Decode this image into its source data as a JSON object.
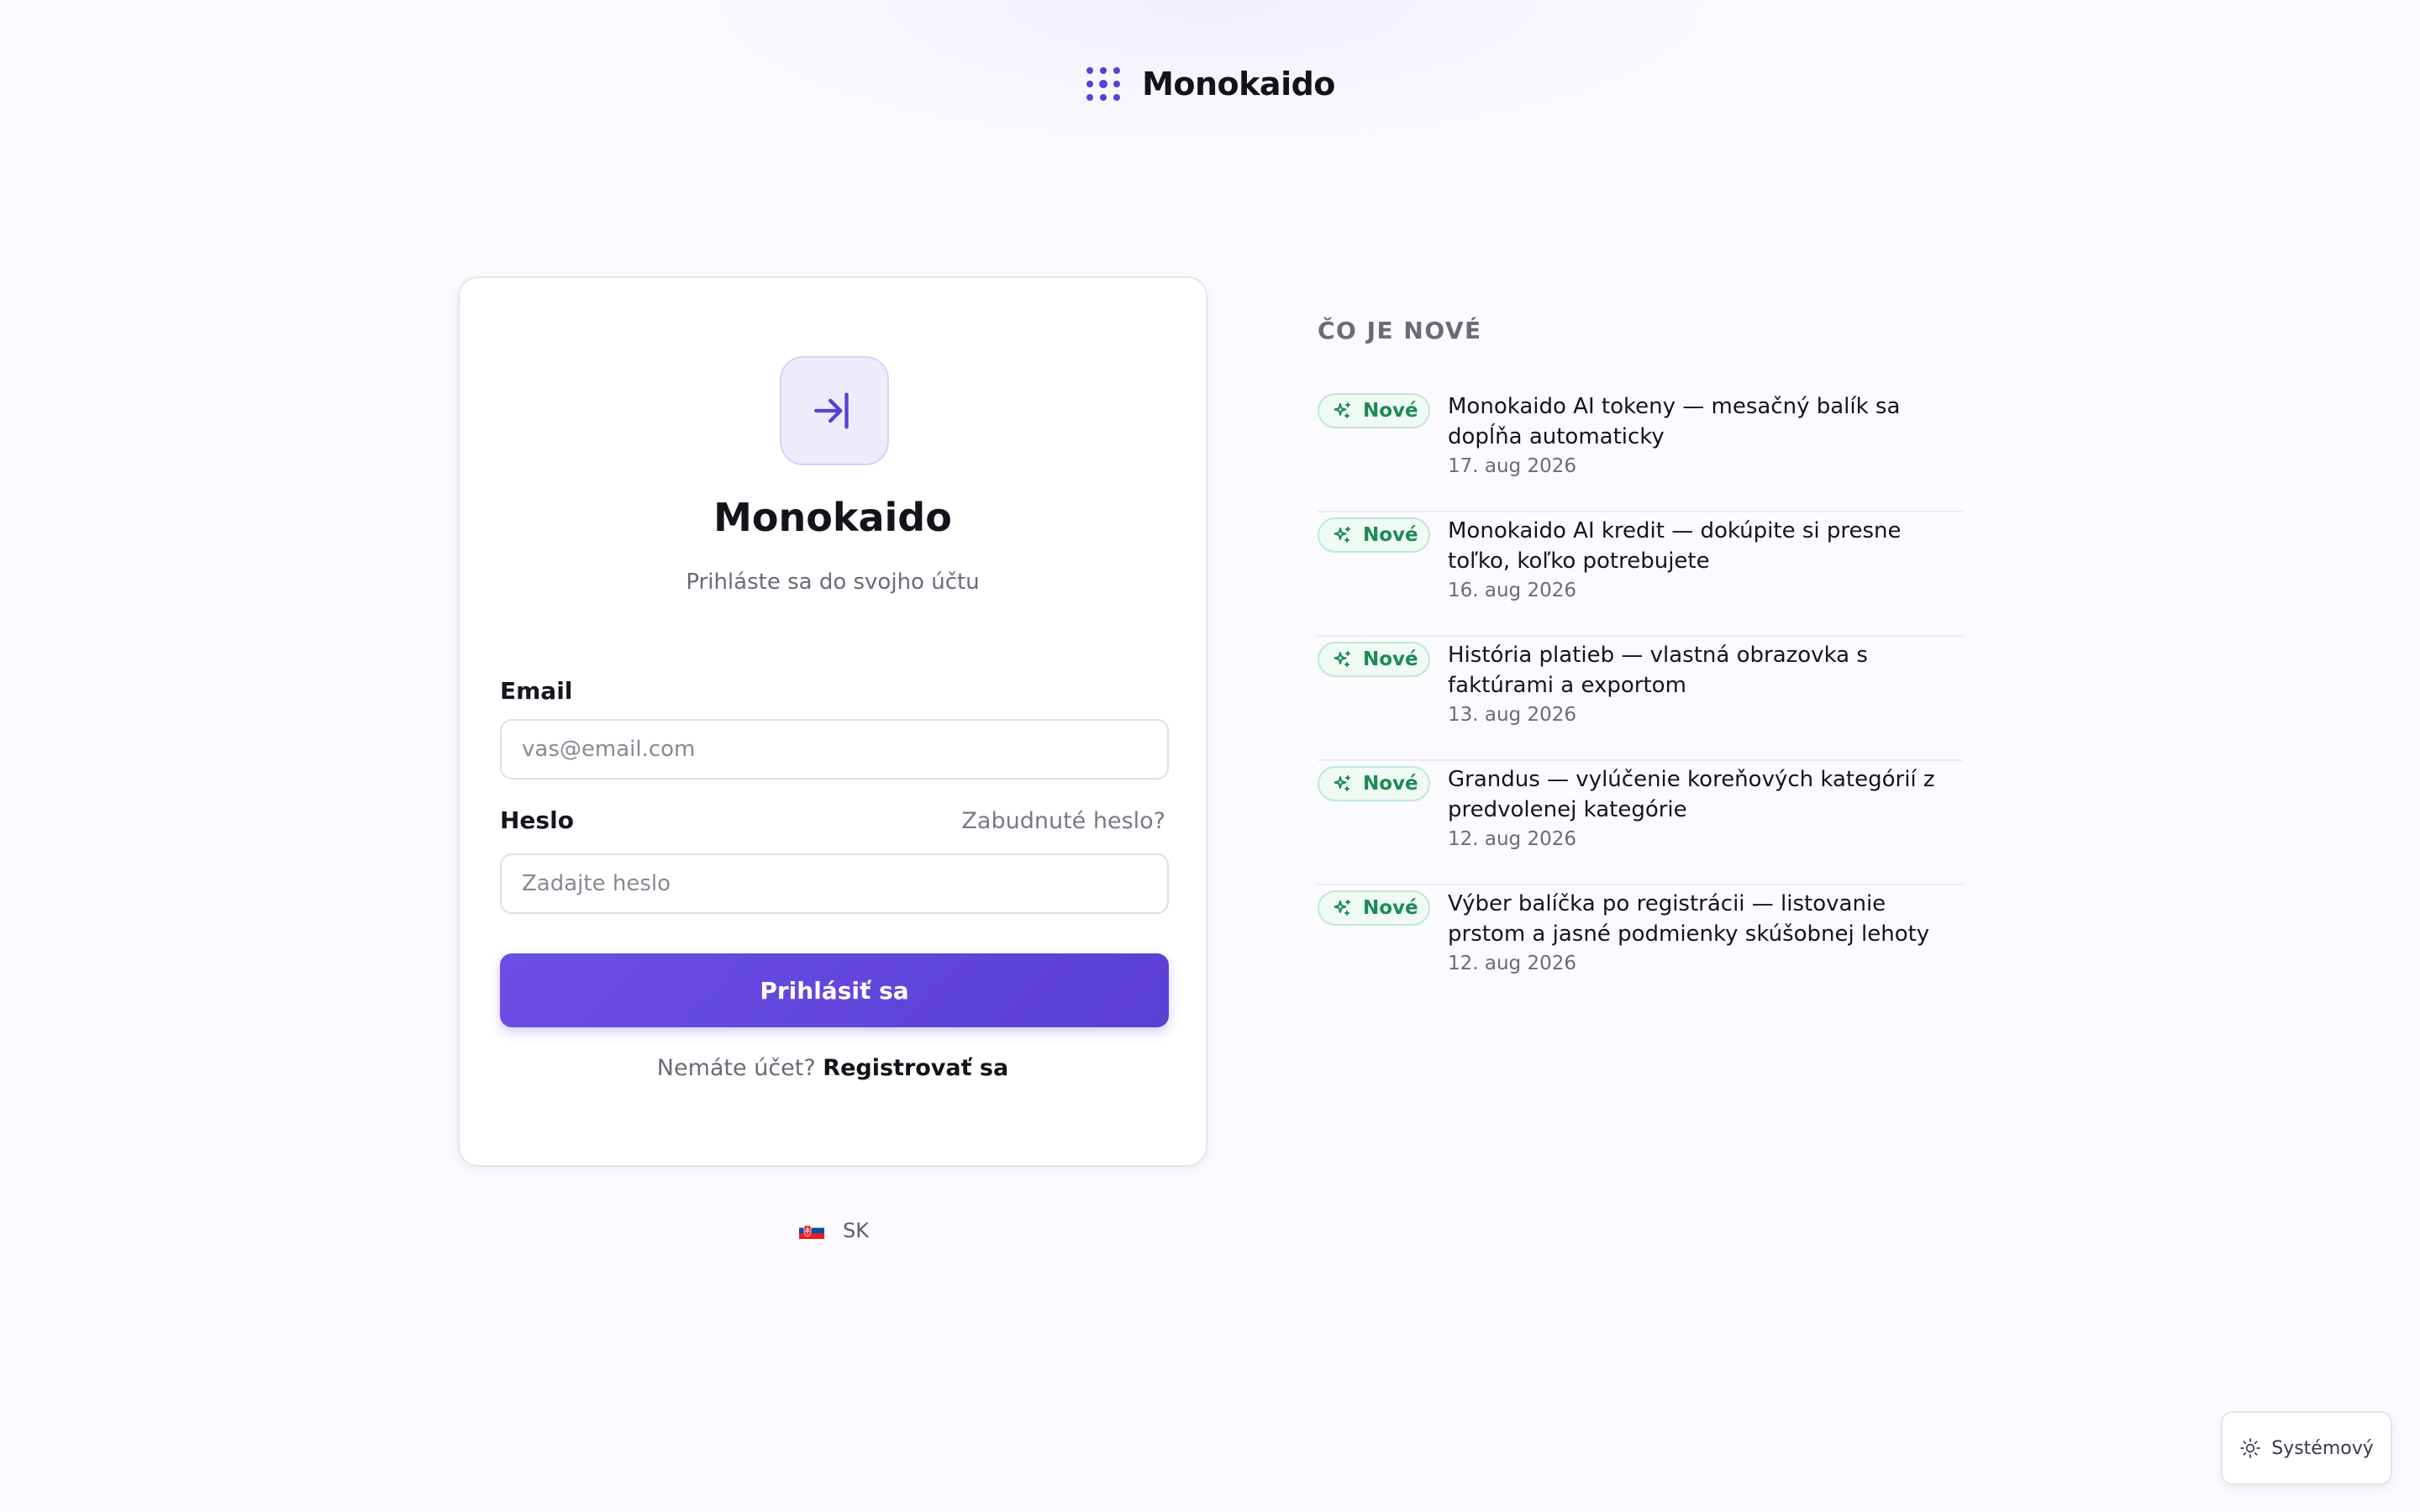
{
  "brand": {
    "name": "Monokaido",
    "logo_icon": "dot-grid-icon",
    "accent": "#5b3fd6"
  },
  "login": {
    "icon": "sign-in-arrow-icon",
    "title": "Monokaido",
    "subtitle": "Prihláste sa do svojho účtu",
    "email_label": "Email",
    "email_placeholder": "vas@email.com",
    "email_value": "",
    "password_label": "Heslo",
    "password_placeholder": "Zadajte heslo",
    "password_value": "",
    "forgot_label": "Zabudnuté heslo?",
    "submit_label": "Prihlásiť sa",
    "register_question": "Nemáte účet?",
    "register_label": "Registrovať sa"
  },
  "language": {
    "flag_icon": "slovakia-flag-icon",
    "code": "SK"
  },
  "whats_new": {
    "heading": "ČO JE NOVÉ",
    "badge_color": "#1d8a55",
    "items": [
      {
        "badge": "Nové",
        "title": "Monokaido AI tokeny — mesačný balík sa dopĺňa automaticky",
        "date": "17. aug 2026"
      },
      {
        "badge": "Nové",
        "title": "Monokaido AI kredit — dokúpite si presne toľko, koľko potrebujete",
        "date": "16. aug 2026"
      },
      {
        "badge": "Nové",
        "title": "História platieb — vlastná obrazovka s faktúrami a exportom",
        "date": "13. aug 2026"
      },
      {
        "badge": "Nové",
        "title": "Grandus — vylúčenie koreňových kategórií z predvolenej kategórie",
        "date": "12. aug 2026"
      },
      {
        "badge": "Nové",
        "title": "Výber balíčka po registrácii — listovanie prstom a jasné podmienky skúšobnej lehoty",
        "date": "12. aug 2026"
      }
    ]
  },
  "theme": {
    "icon": "sun-icon",
    "label": "Systémový"
  }
}
